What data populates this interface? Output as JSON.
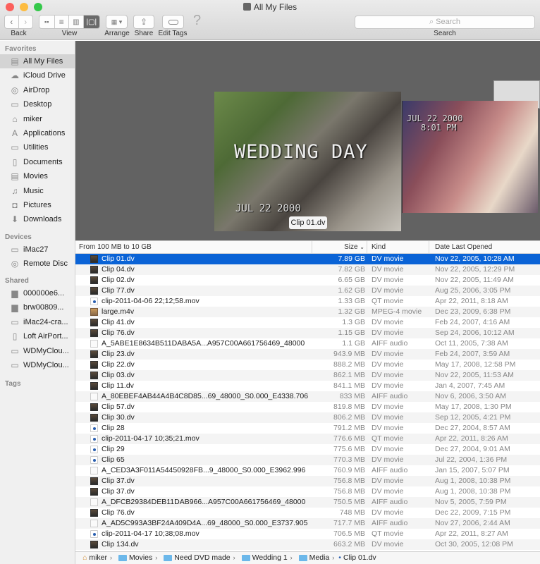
{
  "window": {
    "title": "All My Files"
  },
  "toolbar": {
    "back": "Back",
    "view": "View",
    "arrange": "Arrange",
    "share": "Share",
    "edit_tags": "Edit Tags",
    "search_placeholder": "Search",
    "search_label": "Search"
  },
  "sidebar": {
    "favorites_header": "Favorites",
    "favorites": [
      {
        "label": "All My Files",
        "icon": "all-files-icon"
      },
      {
        "label": "iCloud Drive",
        "icon": "cloud-icon"
      },
      {
        "label": "AirDrop",
        "icon": "airdrop-icon"
      },
      {
        "label": "Desktop",
        "icon": "desktop-icon"
      },
      {
        "label": "miker",
        "icon": "home-icon"
      },
      {
        "label": "Applications",
        "icon": "applications-icon"
      },
      {
        "label": "Utilities",
        "icon": "folder-icon"
      },
      {
        "label": "Documents",
        "icon": "documents-icon"
      },
      {
        "label": "Movies",
        "icon": "movies-icon"
      },
      {
        "label": "Music",
        "icon": "music-icon"
      },
      {
        "label": "Pictures",
        "icon": "pictures-icon"
      },
      {
        "label": "Downloads",
        "icon": "downloads-icon"
      }
    ],
    "devices_header": "Devices",
    "devices": [
      {
        "label": "iMac27",
        "icon": "imac-icon"
      },
      {
        "label": "Remote Disc",
        "icon": "disc-icon"
      }
    ],
    "shared_header": "Shared",
    "shared": [
      {
        "label": "000000e6...",
        "icon": "computer-icon"
      },
      {
        "label": "brw00809...",
        "icon": "computer-icon"
      },
      {
        "label": "iMac24-cra...",
        "icon": "imac-icon"
      },
      {
        "label": "Loft AirPort...",
        "icon": "airport-icon"
      },
      {
        "label": "WDMyClou...",
        "icon": "nas-icon"
      },
      {
        "label": "WDMyClou...",
        "icon": "nas-icon"
      }
    ],
    "tags_header": "Tags"
  },
  "coverflow": {
    "overlay_title": "WEDDING DAY",
    "overlay_date": "JUL 22 2000",
    "second_date": "JUL 22 2000",
    "second_time": "8:01 PM",
    "tooltip": "Clip 01.dv"
  },
  "columns": {
    "group": "From 100 MB to 10 GB",
    "size": "Size",
    "kind": "Kind",
    "date": "Date Last Opened"
  },
  "files": [
    {
      "name": "Clip 01.dv",
      "size": "7.89 GB",
      "kind": "DV movie",
      "date": "Nov 22, 2005, 10:28 AM",
      "type": "movie",
      "selected": true
    },
    {
      "name": "Clip 04.dv",
      "size": "7.82 GB",
      "kind": "DV movie",
      "date": "Nov 22, 2005, 12:29 PM",
      "type": "movie"
    },
    {
      "name": "Clip 02.dv",
      "size": "6.65 GB",
      "kind": "DV movie",
      "date": "Nov 22, 2005, 11:49 AM",
      "type": "movie"
    },
    {
      "name": "Clip 77.dv",
      "size": "1.62 GB",
      "kind": "DV movie",
      "date": "Aug 25, 2006, 3:05 PM",
      "type": "movie"
    },
    {
      "name": "clip-2011-04-06 22;12;58.mov",
      "size": "1.33 GB",
      "kind": "QT movie",
      "date": "Apr 22, 2011, 8:18 AM",
      "type": "qt"
    },
    {
      "name": "large.m4v",
      "size": "1.32 GB",
      "kind": "MPEG-4 movie",
      "date": "Dec 23, 2009, 6:38 PM",
      "type": "m4v"
    },
    {
      "name": "Clip 41.dv",
      "size": "1.3 GB",
      "kind": "DV movie",
      "date": "Feb 24, 2007, 4:16 AM",
      "type": "movie"
    },
    {
      "name": "Clip 76.dv",
      "size": "1.15 GB",
      "kind": "DV movie",
      "date": "Sep 24, 2006, 10:12 AM",
      "type": "movie"
    },
    {
      "name": "A_5ABE1E8634B511DABA5A...A957C00A661756469_48000",
      "size": "1.1 GB",
      "kind": "AIFF audio",
      "date": "Oct 11, 2005, 7:38 AM",
      "type": "aiff"
    },
    {
      "name": "Clip 23.dv",
      "size": "943.9 MB",
      "kind": "DV movie",
      "date": "Feb 24, 2007, 3:59 AM",
      "type": "movie"
    },
    {
      "name": "Clip 22.dv",
      "size": "888.2 MB",
      "kind": "DV movie",
      "date": "May 17, 2008, 12:58 PM",
      "type": "movie"
    },
    {
      "name": "Clip 03.dv",
      "size": "862.1 MB",
      "kind": "DV movie",
      "date": "Nov 22, 2005, 11:53 AM",
      "type": "movie"
    },
    {
      "name": "Clip 11.dv",
      "size": "841.1 MB",
      "kind": "DV movie",
      "date": "Jan 4, 2007, 7:45 AM",
      "type": "movie"
    },
    {
      "name": "A_80EBEF4AB44A4B4C8D85...69_48000_S0.000_E4338.706",
      "size": "833 MB",
      "kind": "AIFF audio",
      "date": "Nov 6, 2006, 3:50 AM",
      "type": "aiff"
    },
    {
      "name": "Clip 57.dv",
      "size": "819.8 MB",
      "kind": "DV movie",
      "date": "May 17, 2008, 1:30 PM",
      "type": "movie"
    },
    {
      "name": "Clip 30.dv",
      "size": "806.2 MB",
      "kind": "DV movie",
      "date": "Sep 12, 2005, 4:21 PM",
      "type": "movie"
    },
    {
      "name": "Clip 28",
      "size": "791.2 MB",
      "kind": "DV movie",
      "date": "Dec 27, 2004, 8:57 AM",
      "type": "qt"
    },
    {
      "name": "clip-2011-04-17 10;35;21.mov",
      "size": "776.6 MB",
      "kind": "QT movie",
      "date": "Apr 22, 2011, 8:26 AM",
      "type": "qt"
    },
    {
      "name": "Clip 29",
      "size": "775.6 MB",
      "kind": "DV movie",
      "date": "Dec 27, 2004, 9:01 AM",
      "type": "qt"
    },
    {
      "name": "Clip 65",
      "size": "770.3 MB",
      "kind": "DV movie",
      "date": "Jul 22, 2004, 1:36 PM",
      "type": "qt"
    },
    {
      "name": "A_CED3A3F011A54450928FB...9_48000_S0.000_E3962.996",
      "size": "760.9 MB",
      "kind": "AIFF audio",
      "date": "Jan 15, 2007, 5:07 PM",
      "type": "aiff"
    },
    {
      "name": "Clip 37.dv",
      "size": "756.8 MB",
      "kind": "DV movie",
      "date": "Aug 1, 2008, 10:38 PM",
      "type": "movie"
    },
    {
      "name": "Clip 37.dv",
      "size": "756.8 MB",
      "kind": "DV movie",
      "date": "Aug 1, 2008, 10:38 PM",
      "type": "movie"
    },
    {
      "name": "A_DFCB29384DEB11DAB966...A957C00A661756469_48000",
      "size": "750.5 MB",
      "kind": "AIFF audio",
      "date": "Nov 5, 2005, 7:59 PM",
      "type": "aiff"
    },
    {
      "name": "Clip 76.dv",
      "size": "748 MB",
      "kind": "DV movie",
      "date": "Dec 22, 2009, 7:15 PM",
      "type": "movie"
    },
    {
      "name": "A_AD5C993A3BF24A409D4A...69_48000_S0.000_E3737.905",
      "size": "717.7 MB",
      "kind": "AIFF audio",
      "date": "Nov 27, 2006, 2:44 AM",
      "type": "aiff"
    },
    {
      "name": "clip-2011-04-17 10;38;08.mov",
      "size": "706.5 MB",
      "kind": "QT movie",
      "date": "Apr 22, 2011, 8:27 AM",
      "type": "qt"
    },
    {
      "name": "Clip 134.dv",
      "size": "663.2 MB",
      "kind": "DV movie",
      "date": "Oct 30, 2005, 12:08 PM",
      "type": "movie"
    }
  ],
  "path": [
    "miker",
    "Movies",
    "Need DVD made",
    "Wedding 1",
    "Media",
    "Clip 01.dv"
  ],
  "colors": {
    "selection": "#0a63d6",
    "close": "#fc605c",
    "minimize": "#fdbc40",
    "zoom": "#34c84a"
  }
}
